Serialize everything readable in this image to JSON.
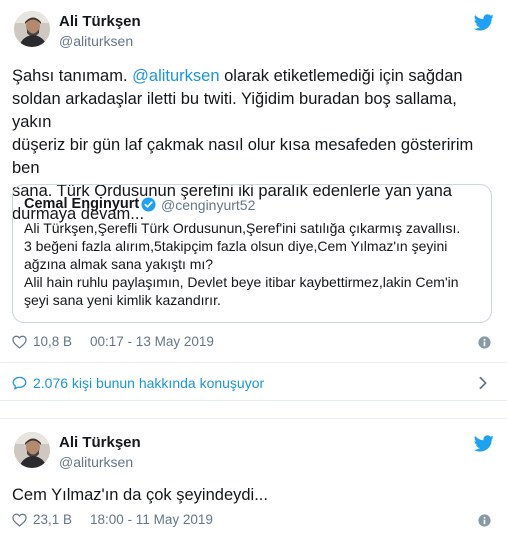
{
  "tweet1": {
    "author_name": "Ali Türkşen",
    "author_handle": "@aliturksen",
    "text_lines": [
      "Şahsı tanımam. ",
      "@aliturksen",
      " olarak etiketlemediği için sağdan",
      "soldan arkadaşlar iletti bu twiti. Yiğidim buradan boş sallama, yakın",
      "düşeriz bir gün laf çakmak nasıl olur kısa mesafeden gösteririm ben",
      "sana. Türk Ordusunun şerefini iki paralık edenlerle yan yana",
      "durmaya devam..."
    ],
    "quote": {
      "author_name": "Cemal Enginyurt",
      "author_handle": "@cenginyurt52",
      "lines": [
        "Ali Türkşen,Şerefli Türk Ordusunun,Şeref'ini satılığa çıkarmış zavallısı.",
        "3 beğeni fazla alırım,5takipçim fazla olsun diye,Cem Yılmaz'ın şeyini",
        "ağzına almak sana yakıştı mı?",
        "Alil hain ruhlu paylaşımın, Devlet beye itibar kaybettirmez,lakin Cem'in",
        "şeyi sana yeni kimlik kazandırır."
      ]
    },
    "likes": "10,8 B",
    "timestamp": "00:17 - 13 May 2019",
    "conversation_link": "2.076 kişi bunun hakkında konuşuyor"
  },
  "tweet2": {
    "author_name": "Ali Türkşen",
    "author_handle": "@aliturksen",
    "text": "Cem Yılmaz'ın da çok şeyindeydi...",
    "likes": "23,1 B",
    "timestamp": "18:00 - 11 May 2019"
  },
  "icons": {
    "brand": "twitter-bird-icon",
    "like": "heart-icon",
    "info": "info-icon",
    "reply": "speech-bubble-icon",
    "more": "chevron-right-icon",
    "verified": "verified-badge-icon"
  },
  "colors": {
    "accent": "#1b95e0",
    "text": "#14171a",
    "muted": "#657786",
    "border": "#ccd6dd"
  }
}
